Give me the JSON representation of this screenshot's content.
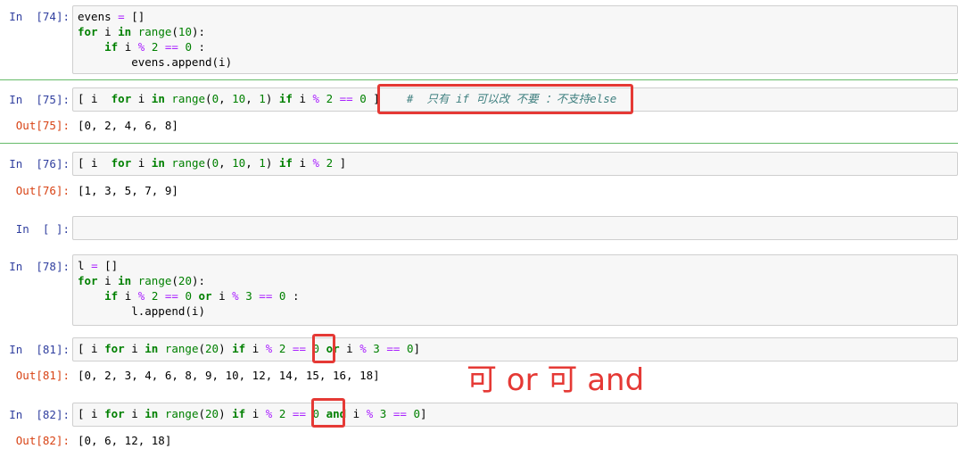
{
  "cells": [
    {
      "id": "c74",
      "in_prompt": "In  [74]:",
      "code_lines": [
        "evens = []",
        "for i in range(10):",
        "    if i % 2 == 0 :",
        "        evens.append(i)"
      ]
    },
    {
      "id": "c75",
      "in_prompt": "In  [75]:",
      "code": "[ i  for i in range(0, 10, 1) if i % 2 == 0 ]",
      "comment": "#  只有 if 可以改 不要 ：不支持else",
      "out_prompt": "Out[75]:",
      "output": "[0, 2, 4, 6, 8]"
    },
    {
      "id": "c76",
      "in_prompt": "In  [76]:",
      "code": "[ i  for i in range(0, 10, 1) if i % 2 ]",
      "out_prompt": "Out[76]:",
      "output": "[1, 3, 5, 7, 9]"
    },
    {
      "id": "cEmpty",
      "in_prompt": "In  [ ]:"
    },
    {
      "id": "c78",
      "in_prompt": "In  [78]:",
      "code_lines": [
        "l = []",
        "for i in range(20):",
        "    if i % 2 == 0 or i % 3 == 0 :",
        "        l.append(i)"
      ]
    },
    {
      "id": "c81",
      "in_prompt": "In  [81]:",
      "code": "[ i for i in range(20) if i % 2 == 0 or i % 3 == 0]",
      "out_prompt": "Out[81]:",
      "output": "[0, 2, 3, 4, 6, 8, 9, 10, 12, 14, 15, 16, 18]"
    },
    {
      "id": "c82",
      "in_prompt": "In  [82]:",
      "code": "[ i for i in range(20) if i % 2 == 0 and i % 3 == 0]",
      "out_prompt": "Out[82]:",
      "output": "[0, 6, 12, 18]"
    }
  ],
  "annotation": "可 or 可 and",
  "colors": {
    "keyword": "#008000",
    "operator": "#aa22ff",
    "in_prompt": "#303f9f",
    "out_prompt": "#d84315",
    "highlight": "#e53935",
    "separator": "#66bb6a",
    "cell_bg": "#f7f7f7"
  }
}
